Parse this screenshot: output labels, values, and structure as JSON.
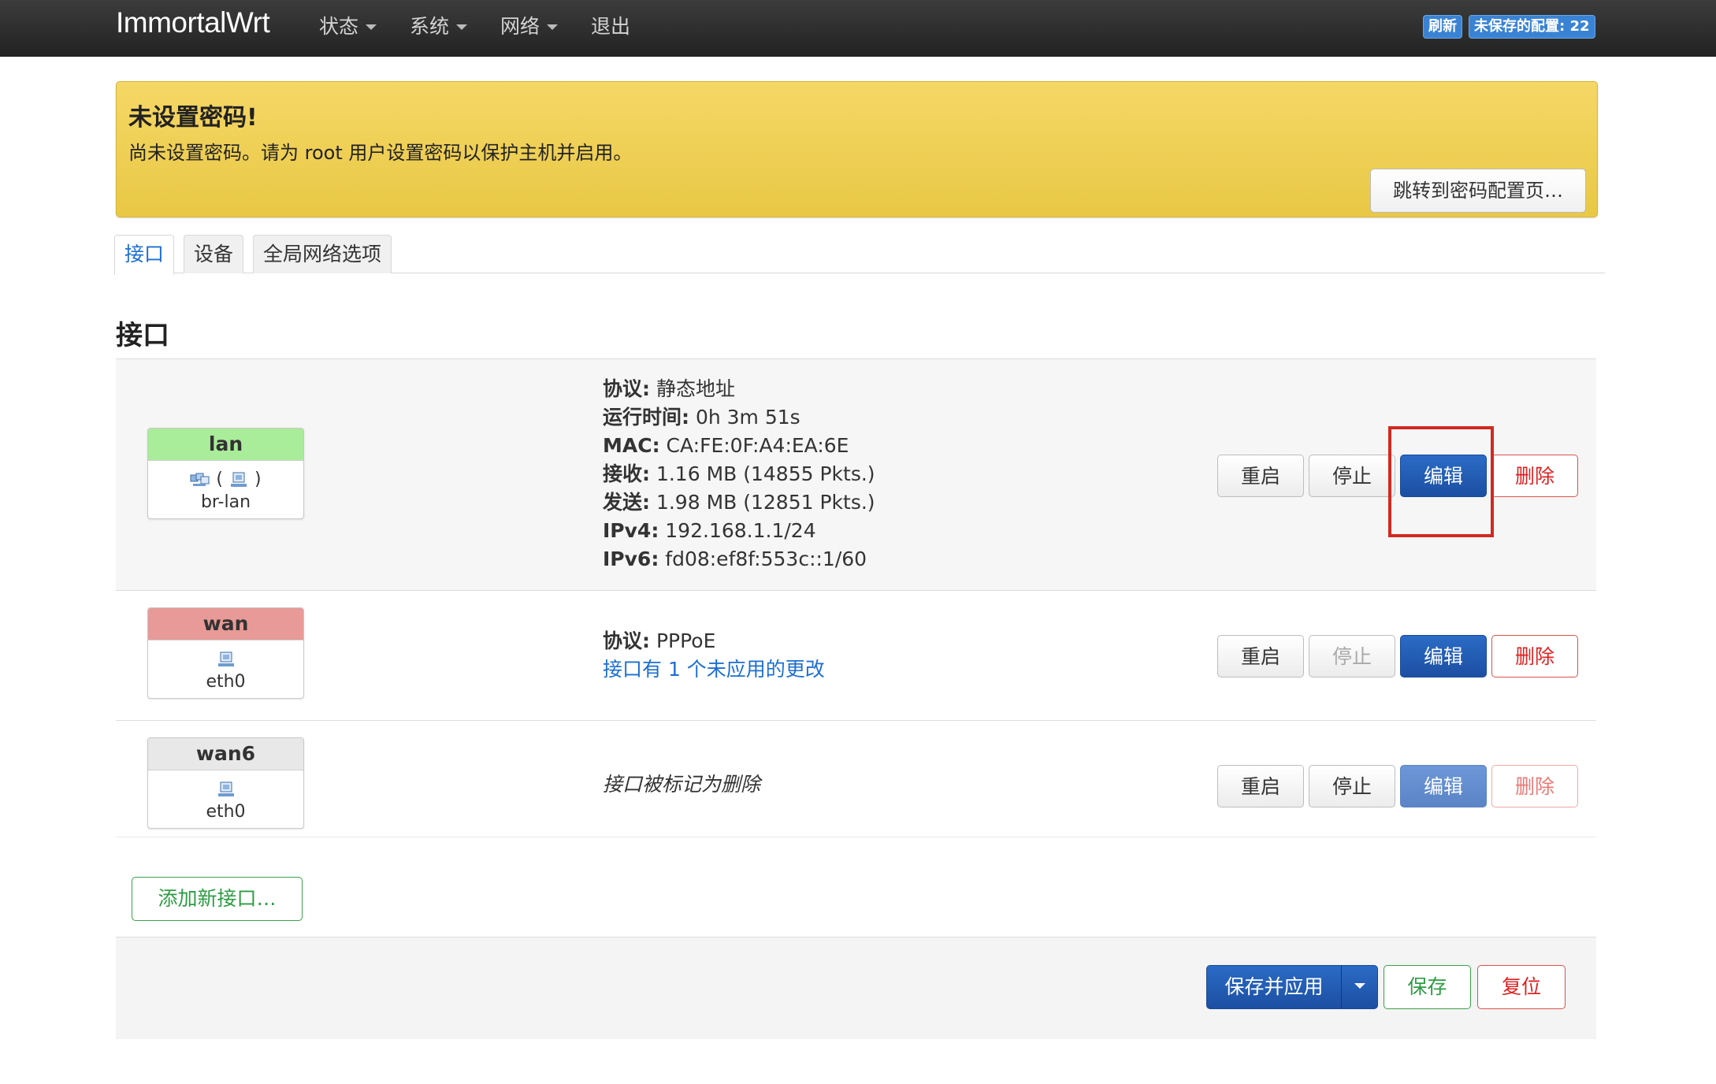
{
  "navbar": {
    "brand": "ImmortalWrt",
    "menu": [
      "状态",
      "系统",
      "网络",
      "退出"
    ],
    "refresh_badge": "刷新",
    "unsaved_badge": "未保存的配置: 22"
  },
  "alert": {
    "title": "未设置密码!",
    "text": "尚未设置密码。请为 root 用户设置密码以保护主机并启用。",
    "button": "跳转到密码配置页…"
  },
  "tabs": [
    "接口",
    "设备",
    "全局网络选项"
  ],
  "section_title": "接口",
  "interfaces": [
    {
      "name": "lan",
      "header_color": "#a9ec9a",
      "device": "br-lan",
      "info": [
        {
          "label": "协议:",
          "value": "静态地址"
        },
        {
          "label": "运行时间:",
          "value": "0h 3m 51s"
        },
        {
          "label": "MAC:",
          "value": "CA:FE:0F:A4:EA:6E"
        },
        {
          "label": "接收:",
          "value": "1.16 MB (14855 Pkts.)"
        },
        {
          "label": "发送:",
          "value": "1.98 MB (12851 Pkts.)"
        },
        {
          "label": "IPv4:",
          "value": "192.168.1.1/24"
        },
        {
          "label": "IPv6:",
          "value": "fd08:ef8f:553c::1/60"
        }
      ]
    },
    {
      "name": "wan",
      "header_color": "#e79a97",
      "device": "eth0",
      "info": [
        {
          "label": "协议:",
          "value": "PPPoE"
        }
      ],
      "pending_note": "接口有 1 个未应用的更改"
    },
    {
      "name": "wan6",
      "header_color": "#e8e8e8",
      "device": "eth0",
      "deleted_note": "接口被标记为删除"
    }
  ],
  "row_buttons": {
    "restart": "重启",
    "stop": "停止",
    "edit": "编辑",
    "delete": "删除"
  },
  "add_button": "添加新接口…",
  "footer": {
    "save_apply": "保存并应用",
    "save": "保存",
    "reset": "复位"
  }
}
